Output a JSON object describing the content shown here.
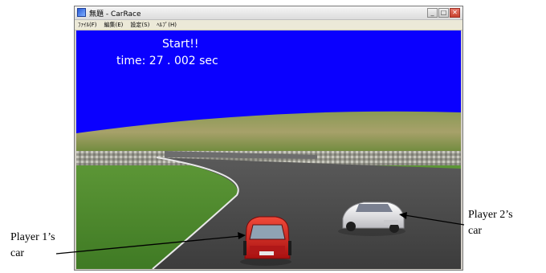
{
  "window": {
    "title": "無題 - CarRace",
    "buttons": {
      "minimize": "_",
      "maximize": "□",
      "close": "✕"
    }
  },
  "menu": [
    {
      "label": "ﾌｧｲﾙ(F)"
    },
    {
      "label": "編集(E)"
    },
    {
      "label": "設定(S)"
    },
    {
      "label": "ﾍﾙﾌﾟ(H)"
    }
  ],
  "hud": {
    "status": "Start!!",
    "time": "time: 27 . 002 sec"
  },
  "annotations": {
    "player1": {
      "line1": "Player 1’s",
      "line2": "car"
    },
    "player2": {
      "line1": "Player 2’s",
      "line2": "car"
    }
  },
  "colors": {
    "sky": "#0a00ff",
    "grass": "#4f8a2e",
    "road": "#4a4a4a",
    "player1_car": "#d81c1c",
    "player2_car": "#e8e8ea"
  }
}
